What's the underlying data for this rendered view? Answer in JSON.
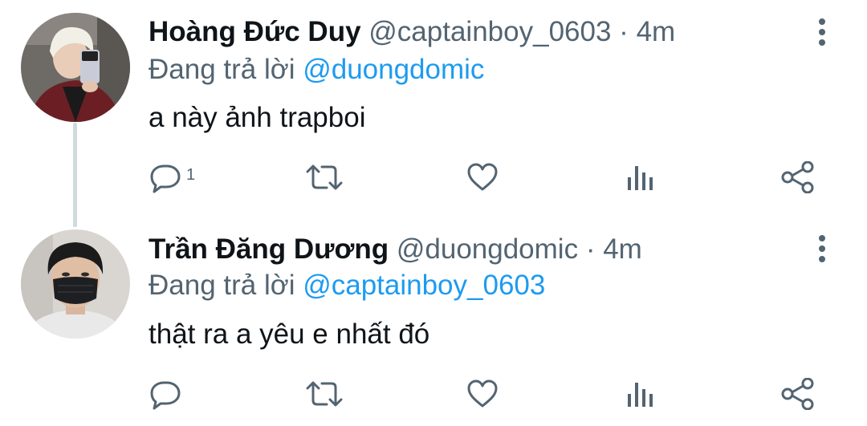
{
  "tweets": [
    {
      "display_name": "Hoàng Đức Duy",
      "handle": "@captainboy_0603",
      "separator": "·",
      "time": "4m",
      "replying_prefix": "Đang trả lời",
      "replying_to": "@duongdomic",
      "text": "a này ảnh trapboi",
      "reply_count": "1"
    },
    {
      "display_name": "Trần Đăng Dương",
      "handle": "@duongdomic",
      "separator": "·",
      "time": "4m",
      "replying_prefix": "Đang trả lời",
      "replying_to": "@captainboy_0603",
      "text": "thật ra a yêu e nhất đó",
      "reply_count": ""
    }
  ],
  "icons": {
    "reply": "reply-icon",
    "retweet": "retweet-icon",
    "like": "heart-icon",
    "views": "views-icon",
    "share": "share-icon",
    "more": "more-vertical-icon"
  },
  "colors": {
    "name": "#0f1419",
    "secondary": "#536471",
    "link": "#1d9bf0",
    "thread_line": "#cfd9de"
  }
}
